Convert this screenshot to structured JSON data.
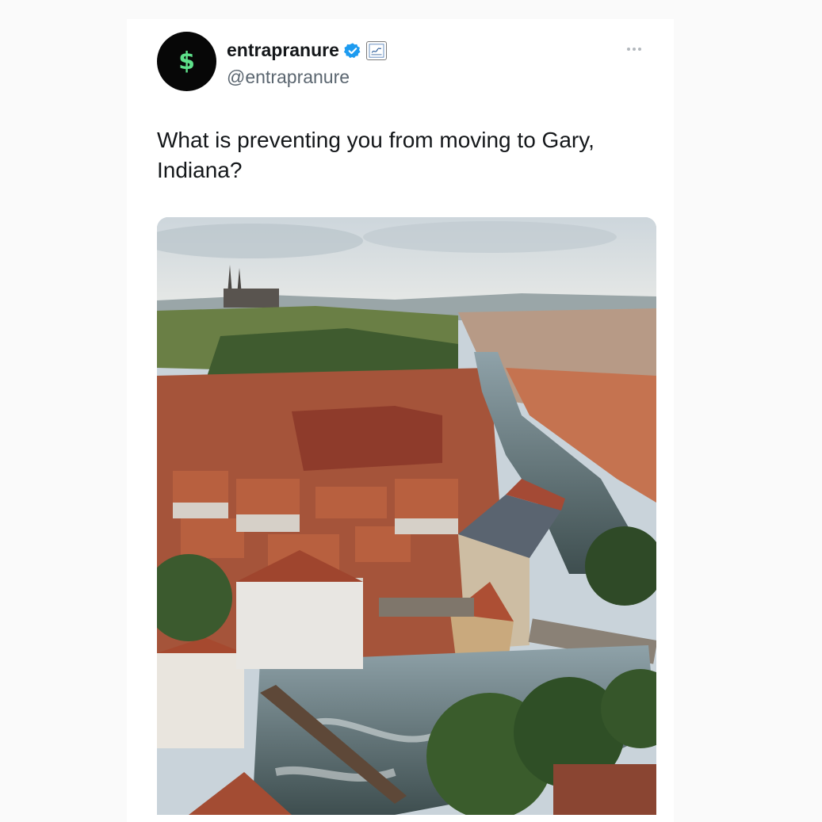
{
  "tweet": {
    "author": {
      "display_name": "entrapranure",
      "handle": "@entrapranure",
      "avatar_glyph": "$",
      "verified_icon": "verified-badge-icon",
      "affiliate_icon": "affiliate-badge-icon"
    },
    "more_icon": "more-horizontal-icon",
    "text": "What is preventing you from moving to Gary, Indiana?",
    "media": {
      "description_icon": "city-photo-image"
    }
  },
  "colors": {
    "avatar_bg": "#070707",
    "avatar_glyph": "#5ee08a",
    "verified": "#1d9bf0",
    "text": "#14171a",
    "muted": "#5b6670"
  }
}
